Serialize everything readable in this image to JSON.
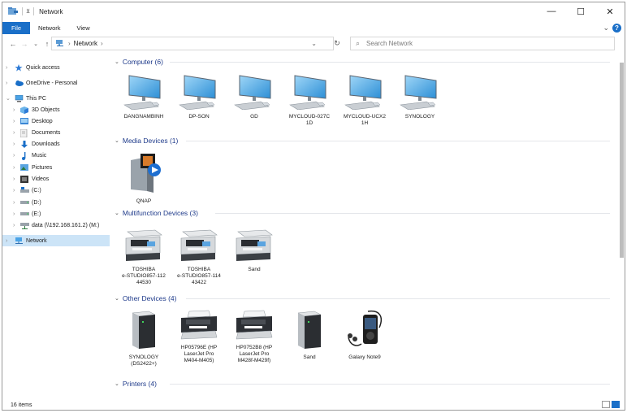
{
  "window": {
    "title": "Network",
    "controls": {
      "minimize": "—",
      "maximize": "☐",
      "close": "✕"
    }
  },
  "ribbon": {
    "tabs": [
      {
        "label": "File"
      },
      {
        "label": "Network"
      },
      {
        "label": "View"
      }
    ],
    "expand": "⌄",
    "help": "?"
  },
  "navbar": {
    "back": "←",
    "forward": "→",
    "recent": "⌄",
    "up": "↑",
    "breadcrumb": "Network",
    "breadcrumb_chevron": "›",
    "address_dropdown": "⌄",
    "refresh": "↻",
    "search_icon": "⌕",
    "search_placeholder": "Search Network"
  },
  "sidebar": {
    "items": [
      {
        "label": "Quick access",
        "icon": "star-icon",
        "expander": "›",
        "indent": 0,
        "selected": false
      },
      {
        "label": "OneDrive - Personal",
        "icon": "cloud-icon",
        "expander": "›",
        "indent": 0,
        "selected": false
      },
      {
        "label": "This PC",
        "icon": "computer-icon",
        "expander": "⌄",
        "indent": 0,
        "selected": false
      },
      {
        "label": "3D Objects",
        "icon": "cube-icon",
        "expander": "›",
        "indent": 1,
        "selected": false
      },
      {
        "label": "Desktop",
        "icon": "desktop-folder-icon",
        "expander": "›",
        "indent": 1,
        "selected": false
      },
      {
        "label": "Documents",
        "icon": "documents-icon",
        "expander": "›",
        "indent": 1,
        "selected": false
      },
      {
        "label": "Downloads",
        "icon": "download-icon",
        "expander": "›",
        "indent": 1,
        "selected": false
      },
      {
        "label": "Music",
        "icon": "music-icon",
        "expander": "›",
        "indent": 1,
        "selected": false
      },
      {
        "label": "Pictures",
        "icon": "pictures-icon",
        "expander": "›",
        "indent": 1,
        "selected": false
      },
      {
        "label": "Videos",
        "icon": "videos-icon",
        "expander": "›",
        "indent": 1,
        "selected": false
      },
      {
        "label": "(C:)",
        "icon": "system-drive-icon",
        "expander": "›",
        "indent": 1,
        "selected": false
      },
      {
        "label": "(D:)",
        "icon": "drive-icon",
        "expander": "›",
        "indent": 1,
        "selected": false
      },
      {
        "label": "(E:)",
        "icon": "drive-icon",
        "expander": "›",
        "indent": 1,
        "selected": false
      },
      {
        "label": "data (\\\\192.168.161.2) (M:)",
        "icon": "network-drive-icon",
        "expander": "›",
        "indent": 1,
        "selected": false
      },
      {
        "label": "Network",
        "icon": "network-icon",
        "expander": "›",
        "indent": 0,
        "selected": true
      }
    ]
  },
  "groups": [
    {
      "name": "Computer (6)",
      "chevron": "⌄",
      "items": [
        {
          "label": "DANGNAMBINH",
          "icon": "computer-icon"
        },
        {
          "label": "DP-SON",
          "icon": "computer-icon"
        },
        {
          "label": "GD",
          "icon": "computer-icon"
        },
        {
          "label": "MYCLOUD-027C\n1D",
          "icon": "computer-icon"
        },
        {
          "label": "MYCLOUD-UCX2\n1H",
          "icon": "computer-icon"
        },
        {
          "label": "SYNOLOGY",
          "icon": "computer-icon"
        }
      ]
    },
    {
      "name": "Media Devices (1)",
      "chevron": "⌄",
      "items": [
        {
          "label": "QNAP",
          "icon": "media-server-icon"
        }
      ]
    },
    {
      "name": "Multifunction Devices (3)",
      "chevron": "⌄",
      "items": [
        {
          "label": "TOSHIBA\ne-STUDIO857-112\n44530",
          "icon": "multifunction-printer-icon"
        },
        {
          "label": "TOSHIBA\ne-STUDIO857-114\n43422",
          "icon": "multifunction-printer-icon"
        },
        {
          "label": "Sand",
          "icon": "multifunction-printer-icon"
        }
      ]
    },
    {
      "name": "Other Devices (4)",
      "chevron": "⌄",
      "items": [
        {
          "label": "SYNOLOGY\n(DS2422+)",
          "icon": "server-icon"
        },
        {
          "label": "HP05796E (HP\nLaserJet Pro\nM404-M405)",
          "icon": "printer-icon"
        },
        {
          "label": "HP0752B8 (HP\nLaserJet Pro\nM428f-M429f)",
          "icon": "printer-icon"
        },
        {
          "label": "Sand",
          "icon": "server-icon"
        },
        {
          "label": "Galaxy Note9",
          "icon": "media-player-icon"
        }
      ]
    },
    {
      "name": "Printers (4)",
      "chevron": "⌄",
      "items": []
    }
  ],
  "status": {
    "count": "16 items"
  },
  "colors": {
    "accent": "#1a6fc8",
    "header": "#1e3a8a",
    "selected": "#cce4f7"
  }
}
